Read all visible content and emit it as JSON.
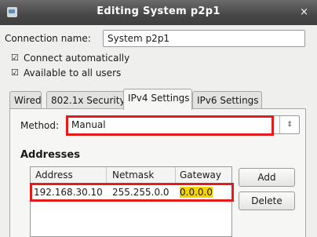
{
  "window": {
    "title": "Editing System p2p1",
    "close_glyph": "×",
    "app_icon": "network-settings-icon"
  },
  "connection": {
    "name_label": "Connection name:",
    "name_value": "System p2p1",
    "connect_auto_label": "Connect automatically",
    "connect_auto_checked": true,
    "all_users_label": "Available to all users",
    "all_users_checked": true,
    "check_glyph": "☑"
  },
  "tabs": [
    {
      "label": "Wired",
      "active": false
    },
    {
      "label": "802.1x Security",
      "active": false
    },
    {
      "label": "IPv4 Settings",
      "active": true
    },
    {
      "label": "IPv6 Settings",
      "active": false
    }
  ],
  "ipv4": {
    "method_label": "Method:",
    "method_value": "Manual",
    "combo_glyph": "⇕",
    "addresses_heading": "Addresses",
    "columns": [
      "Address",
      "Netmask",
      "Gateway"
    ],
    "rows": [
      {
        "address": "192.168.30.10",
        "netmask": "255.255.0.0",
        "gateway": "0.0.0.0"
      }
    ],
    "add_label": "Add",
    "delete_label": "Delete"
  },
  "colors": {
    "highlight": "#e21b1b",
    "gateway_highlight": "#f5d400",
    "titlebar": "#474747"
  }
}
